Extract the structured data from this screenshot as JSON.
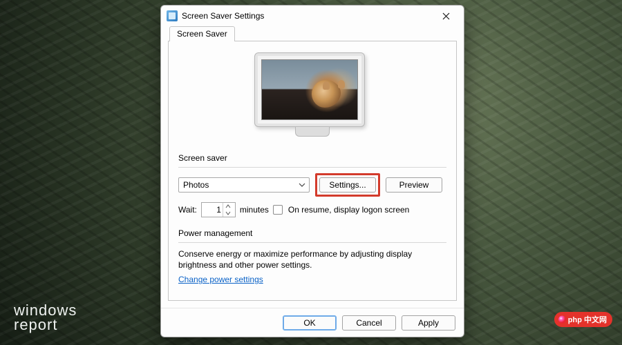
{
  "window": {
    "title": "Screen Saver Settings",
    "tab_label": "Screen Saver",
    "icon": "screensaver-app-icon"
  },
  "screensaver": {
    "group_label": "Screen saver",
    "selected": "Photos",
    "settings_button": "Settings...",
    "preview_button": "Preview",
    "wait_label": "Wait:",
    "wait_value": "1",
    "wait_unit": "minutes",
    "resume_checkbox_label": "On resume, display logon screen",
    "resume_checked": false
  },
  "power": {
    "group_label": "Power management",
    "description": "Conserve energy or maximize performance by adjusting display brightness and other power settings.",
    "link_label": "Change power settings"
  },
  "footer": {
    "ok": "OK",
    "cancel": "Cancel",
    "apply": "Apply"
  },
  "watermarks": {
    "left_line1": "windows",
    "left_line2": "report",
    "right": "中文网"
  }
}
